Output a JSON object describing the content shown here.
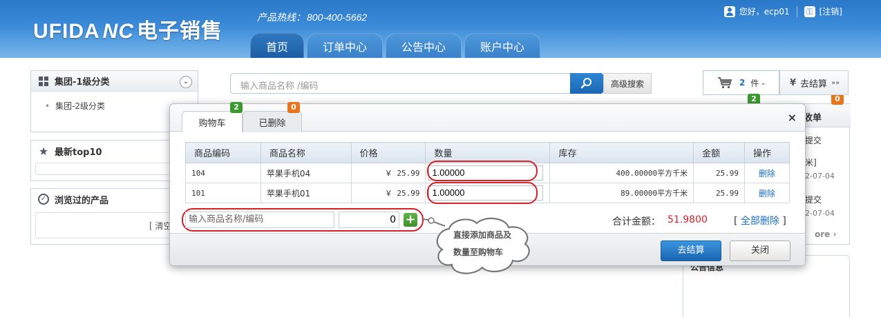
{
  "header": {
    "logo_text": "UFIDA",
    "logo_symbol": "NC",
    "logo_cn": "电子销售",
    "hotline_label": "产品热线：",
    "hotline_number": "800-400-5662",
    "greeting": "您好，ecp01",
    "logout": "[注销]",
    "nav": [
      {
        "label": "首页"
      },
      {
        "label": "订单中心"
      },
      {
        "label": "公告中心"
      },
      {
        "label": "账户中心"
      }
    ]
  },
  "sidebar": {
    "category_title": "集团-1级分类",
    "category_item": "集团-2级分类",
    "top10_title": "最新top10",
    "viewed_title": "浏览过的产品",
    "viewed_clear": "[ 清空"
  },
  "search": {
    "placeholder": "输入商品名称 /编码",
    "advanced": "高级搜索"
  },
  "cart_summary": {
    "count": "2",
    "unit": "件",
    "checkout": "去结算",
    "badge_count": "2"
  },
  "right_panel": {
    "title_partial": "收单",
    "badge": "0",
    "line1": "提交",
    "line2": "米]",
    "date1": "2-07-04",
    "line3": "提交",
    "date2": "2-07-04",
    "more": "ore",
    "notice_title": "公告信息"
  },
  "modal": {
    "tab_cart": "购物车",
    "tab_cart_badge": "2",
    "tab_deleted": "已删除",
    "tab_deleted_badge": "0",
    "close": "×",
    "columns": [
      "商品编码",
      "商品名称",
      "价格",
      "数量",
      "库存",
      "金额",
      "操作"
    ],
    "rows": [
      {
        "code": "104",
        "name": "苹果手机04",
        "price": "￥ 25.99",
        "qty": "1.00000",
        "stock": "400.00000平方千米",
        "amount": "25.99",
        "action": "删除"
      },
      {
        "code": "101",
        "name": "苹果手机01",
        "price": "￥ 25.99",
        "qty": "1.00000",
        "stock": "89.00000平方千米",
        "amount": "25.99",
        "action": "删除"
      }
    ],
    "add_placeholder": "输入商品名称/编码",
    "add_qty": "0",
    "total_label": "合计金额：",
    "total_value": "51.9800",
    "delete_all": "全部删除",
    "checkout_button": "去结算",
    "close_button": "关闭"
  },
  "callout": {
    "line1": "直接添加商品及",
    "line2": "数量至购物车"
  },
  "colors": {
    "header_blue": "#2a78c8",
    "accent_red": "#d81e27",
    "link_blue": "#1b6ec2",
    "badge_green": "#3b9b2f",
    "badge_orange": "#e8751c"
  }
}
